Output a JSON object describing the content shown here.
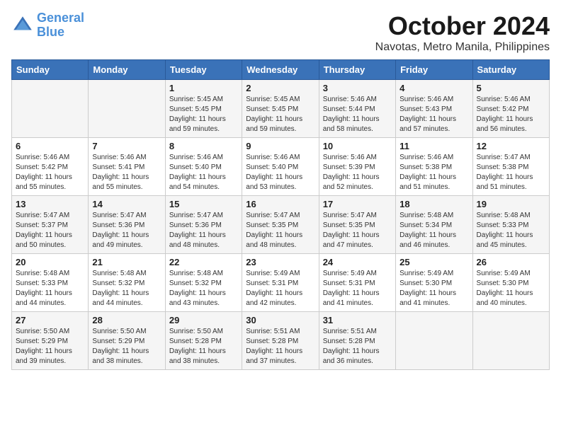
{
  "header": {
    "logo_line1": "General",
    "logo_line2": "Blue",
    "month": "October 2024",
    "location": "Navotas, Metro Manila, Philippines"
  },
  "weekdays": [
    "Sunday",
    "Monday",
    "Tuesday",
    "Wednesday",
    "Thursday",
    "Friday",
    "Saturday"
  ],
  "weeks": [
    [
      {
        "day": "",
        "sunrise": "",
        "sunset": "",
        "daylight": ""
      },
      {
        "day": "",
        "sunrise": "",
        "sunset": "",
        "daylight": ""
      },
      {
        "day": "1",
        "sunrise": "Sunrise: 5:45 AM",
        "sunset": "Sunset: 5:45 PM",
        "daylight": "Daylight: 11 hours and 59 minutes."
      },
      {
        "day": "2",
        "sunrise": "Sunrise: 5:45 AM",
        "sunset": "Sunset: 5:45 PM",
        "daylight": "Daylight: 11 hours and 59 minutes."
      },
      {
        "day": "3",
        "sunrise": "Sunrise: 5:46 AM",
        "sunset": "Sunset: 5:44 PM",
        "daylight": "Daylight: 11 hours and 58 minutes."
      },
      {
        "day": "4",
        "sunrise": "Sunrise: 5:46 AM",
        "sunset": "Sunset: 5:43 PM",
        "daylight": "Daylight: 11 hours and 57 minutes."
      },
      {
        "day": "5",
        "sunrise": "Sunrise: 5:46 AM",
        "sunset": "Sunset: 5:42 PM",
        "daylight": "Daylight: 11 hours and 56 minutes."
      }
    ],
    [
      {
        "day": "6",
        "sunrise": "Sunrise: 5:46 AM",
        "sunset": "Sunset: 5:42 PM",
        "daylight": "Daylight: 11 hours and 55 minutes."
      },
      {
        "day": "7",
        "sunrise": "Sunrise: 5:46 AM",
        "sunset": "Sunset: 5:41 PM",
        "daylight": "Daylight: 11 hours and 55 minutes."
      },
      {
        "day": "8",
        "sunrise": "Sunrise: 5:46 AM",
        "sunset": "Sunset: 5:40 PM",
        "daylight": "Daylight: 11 hours and 54 minutes."
      },
      {
        "day": "9",
        "sunrise": "Sunrise: 5:46 AM",
        "sunset": "Sunset: 5:40 PM",
        "daylight": "Daylight: 11 hours and 53 minutes."
      },
      {
        "day": "10",
        "sunrise": "Sunrise: 5:46 AM",
        "sunset": "Sunset: 5:39 PM",
        "daylight": "Daylight: 11 hours and 52 minutes."
      },
      {
        "day": "11",
        "sunrise": "Sunrise: 5:46 AM",
        "sunset": "Sunset: 5:38 PM",
        "daylight": "Daylight: 11 hours and 51 minutes."
      },
      {
        "day": "12",
        "sunrise": "Sunrise: 5:47 AM",
        "sunset": "Sunset: 5:38 PM",
        "daylight": "Daylight: 11 hours and 51 minutes."
      }
    ],
    [
      {
        "day": "13",
        "sunrise": "Sunrise: 5:47 AM",
        "sunset": "Sunset: 5:37 PM",
        "daylight": "Daylight: 11 hours and 50 minutes."
      },
      {
        "day": "14",
        "sunrise": "Sunrise: 5:47 AM",
        "sunset": "Sunset: 5:36 PM",
        "daylight": "Daylight: 11 hours and 49 minutes."
      },
      {
        "day": "15",
        "sunrise": "Sunrise: 5:47 AM",
        "sunset": "Sunset: 5:36 PM",
        "daylight": "Daylight: 11 hours and 48 minutes."
      },
      {
        "day": "16",
        "sunrise": "Sunrise: 5:47 AM",
        "sunset": "Sunset: 5:35 PM",
        "daylight": "Daylight: 11 hours and 48 minutes."
      },
      {
        "day": "17",
        "sunrise": "Sunrise: 5:47 AM",
        "sunset": "Sunset: 5:35 PM",
        "daylight": "Daylight: 11 hours and 47 minutes."
      },
      {
        "day": "18",
        "sunrise": "Sunrise: 5:48 AM",
        "sunset": "Sunset: 5:34 PM",
        "daylight": "Daylight: 11 hours and 46 minutes."
      },
      {
        "day": "19",
        "sunrise": "Sunrise: 5:48 AM",
        "sunset": "Sunset: 5:33 PM",
        "daylight": "Daylight: 11 hours and 45 minutes."
      }
    ],
    [
      {
        "day": "20",
        "sunrise": "Sunrise: 5:48 AM",
        "sunset": "Sunset: 5:33 PM",
        "daylight": "Daylight: 11 hours and 44 minutes."
      },
      {
        "day": "21",
        "sunrise": "Sunrise: 5:48 AM",
        "sunset": "Sunset: 5:32 PM",
        "daylight": "Daylight: 11 hours and 44 minutes."
      },
      {
        "day": "22",
        "sunrise": "Sunrise: 5:48 AM",
        "sunset": "Sunset: 5:32 PM",
        "daylight": "Daylight: 11 hours and 43 minutes."
      },
      {
        "day": "23",
        "sunrise": "Sunrise: 5:49 AM",
        "sunset": "Sunset: 5:31 PM",
        "daylight": "Daylight: 11 hours and 42 minutes."
      },
      {
        "day": "24",
        "sunrise": "Sunrise: 5:49 AM",
        "sunset": "Sunset: 5:31 PM",
        "daylight": "Daylight: 11 hours and 41 minutes."
      },
      {
        "day": "25",
        "sunrise": "Sunrise: 5:49 AM",
        "sunset": "Sunset: 5:30 PM",
        "daylight": "Daylight: 11 hours and 41 minutes."
      },
      {
        "day": "26",
        "sunrise": "Sunrise: 5:49 AM",
        "sunset": "Sunset: 5:30 PM",
        "daylight": "Daylight: 11 hours and 40 minutes."
      }
    ],
    [
      {
        "day": "27",
        "sunrise": "Sunrise: 5:50 AM",
        "sunset": "Sunset: 5:29 PM",
        "daylight": "Daylight: 11 hours and 39 minutes."
      },
      {
        "day": "28",
        "sunrise": "Sunrise: 5:50 AM",
        "sunset": "Sunset: 5:29 PM",
        "daylight": "Daylight: 11 hours and 38 minutes."
      },
      {
        "day": "29",
        "sunrise": "Sunrise: 5:50 AM",
        "sunset": "Sunset: 5:28 PM",
        "daylight": "Daylight: 11 hours and 38 minutes."
      },
      {
        "day": "30",
        "sunrise": "Sunrise: 5:51 AM",
        "sunset": "Sunset: 5:28 PM",
        "daylight": "Daylight: 11 hours and 37 minutes."
      },
      {
        "day": "31",
        "sunrise": "Sunrise: 5:51 AM",
        "sunset": "Sunset: 5:28 PM",
        "daylight": "Daylight: 11 hours and 36 minutes."
      },
      {
        "day": "",
        "sunrise": "",
        "sunset": "",
        "daylight": ""
      },
      {
        "day": "",
        "sunrise": "",
        "sunset": "",
        "daylight": ""
      }
    ]
  ]
}
